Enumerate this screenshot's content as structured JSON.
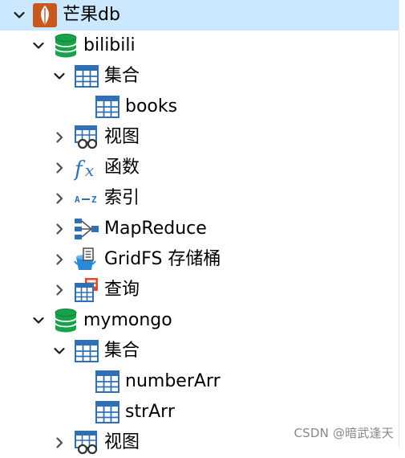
{
  "tree": {
    "connection": {
      "label": "芒果db",
      "icon": "mongodb-leaf-icon",
      "expanded": true,
      "selected": true
    },
    "databases": [
      {
        "label": "bilibili",
        "icon": "database-icon",
        "expanded": true,
        "children": [
          {
            "key": "collections",
            "label": "集合",
            "icon": "table-icon",
            "expanded": true,
            "children": [
              {
                "label": "books",
                "icon": "table-icon"
              }
            ]
          },
          {
            "key": "views",
            "label": "视图",
            "icon": "view-icon",
            "expanded": false
          },
          {
            "key": "functions",
            "label": "函数",
            "icon": "function-icon",
            "expanded": false
          },
          {
            "key": "indexes",
            "label": "索引",
            "icon": "index-az-icon",
            "expanded": false
          },
          {
            "key": "mapreduce",
            "label": "MapReduce",
            "icon": "mapreduce-icon",
            "expanded": false
          },
          {
            "key": "gridfs",
            "label": "GridFS 存储桶",
            "icon": "gridfs-bucket-icon",
            "expanded": false
          },
          {
            "key": "queries",
            "label": "查询",
            "icon": "query-icon",
            "expanded": false
          }
        ]
      },
      {
        "label": "mymongo",
        "icon": "database-icon",
        "expanded": true,
        "children": [
          {
            "key": "collections",
            "label": "集合",
            "icon": "table-icon",
            "expanded": true,
            "children": [
              {
                "label": "numberArr",
                "icon": "table-icon"
              },
              {
                "label": "strArr",
                "icon": "table-icon"
              }
            ]
          },
          {
            "key": "views",
            "label": "视图",
            "icon": "view-icon",
            "expanded": false
          }
        ]
      }
    ]
  },
  "watermark": "CSDN @暗武逢天",
  "colors": {
    "selection": "#cce8ff",
    "database": "#1aa24a",
    "table": "#2f6fb3",
    "mongo_tile": "#c8581e"
  }
}
